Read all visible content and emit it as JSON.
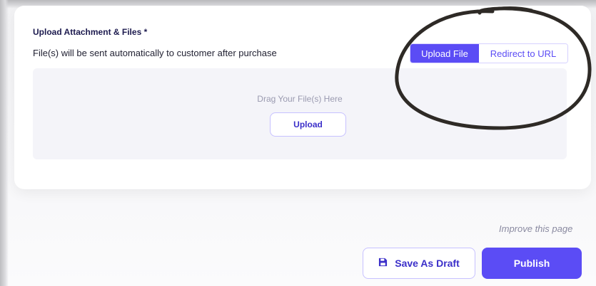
{
  "attachment": {
    "title": "Upload Attachment & Files *",
    "description": "File(s) will be sent automatically to customer after purchase",
    "toggle": {
      "options": [
        "Upload File",
        "Redirect to URL"
      ],
      "selected": "Upload File"
    },
    "dropzone": {
      "hint": "Drag Your File(s) Here",
      "upload_label": "Upload"
    }
  },
  "footer": {
    "improve_link": "Improve this page",
    "save_draft_label": "Save As Draft",
    "publish_label": "Publish"
  },
  "icons": {
    "save_draft": "floppy-disk-icon"
  },
  "colors": {
    "accent": "#5b4cf5",
    "accent_dark_text": "#3b2fc9",
    "annotation_stroke": "#2e2a26"
  }
}
